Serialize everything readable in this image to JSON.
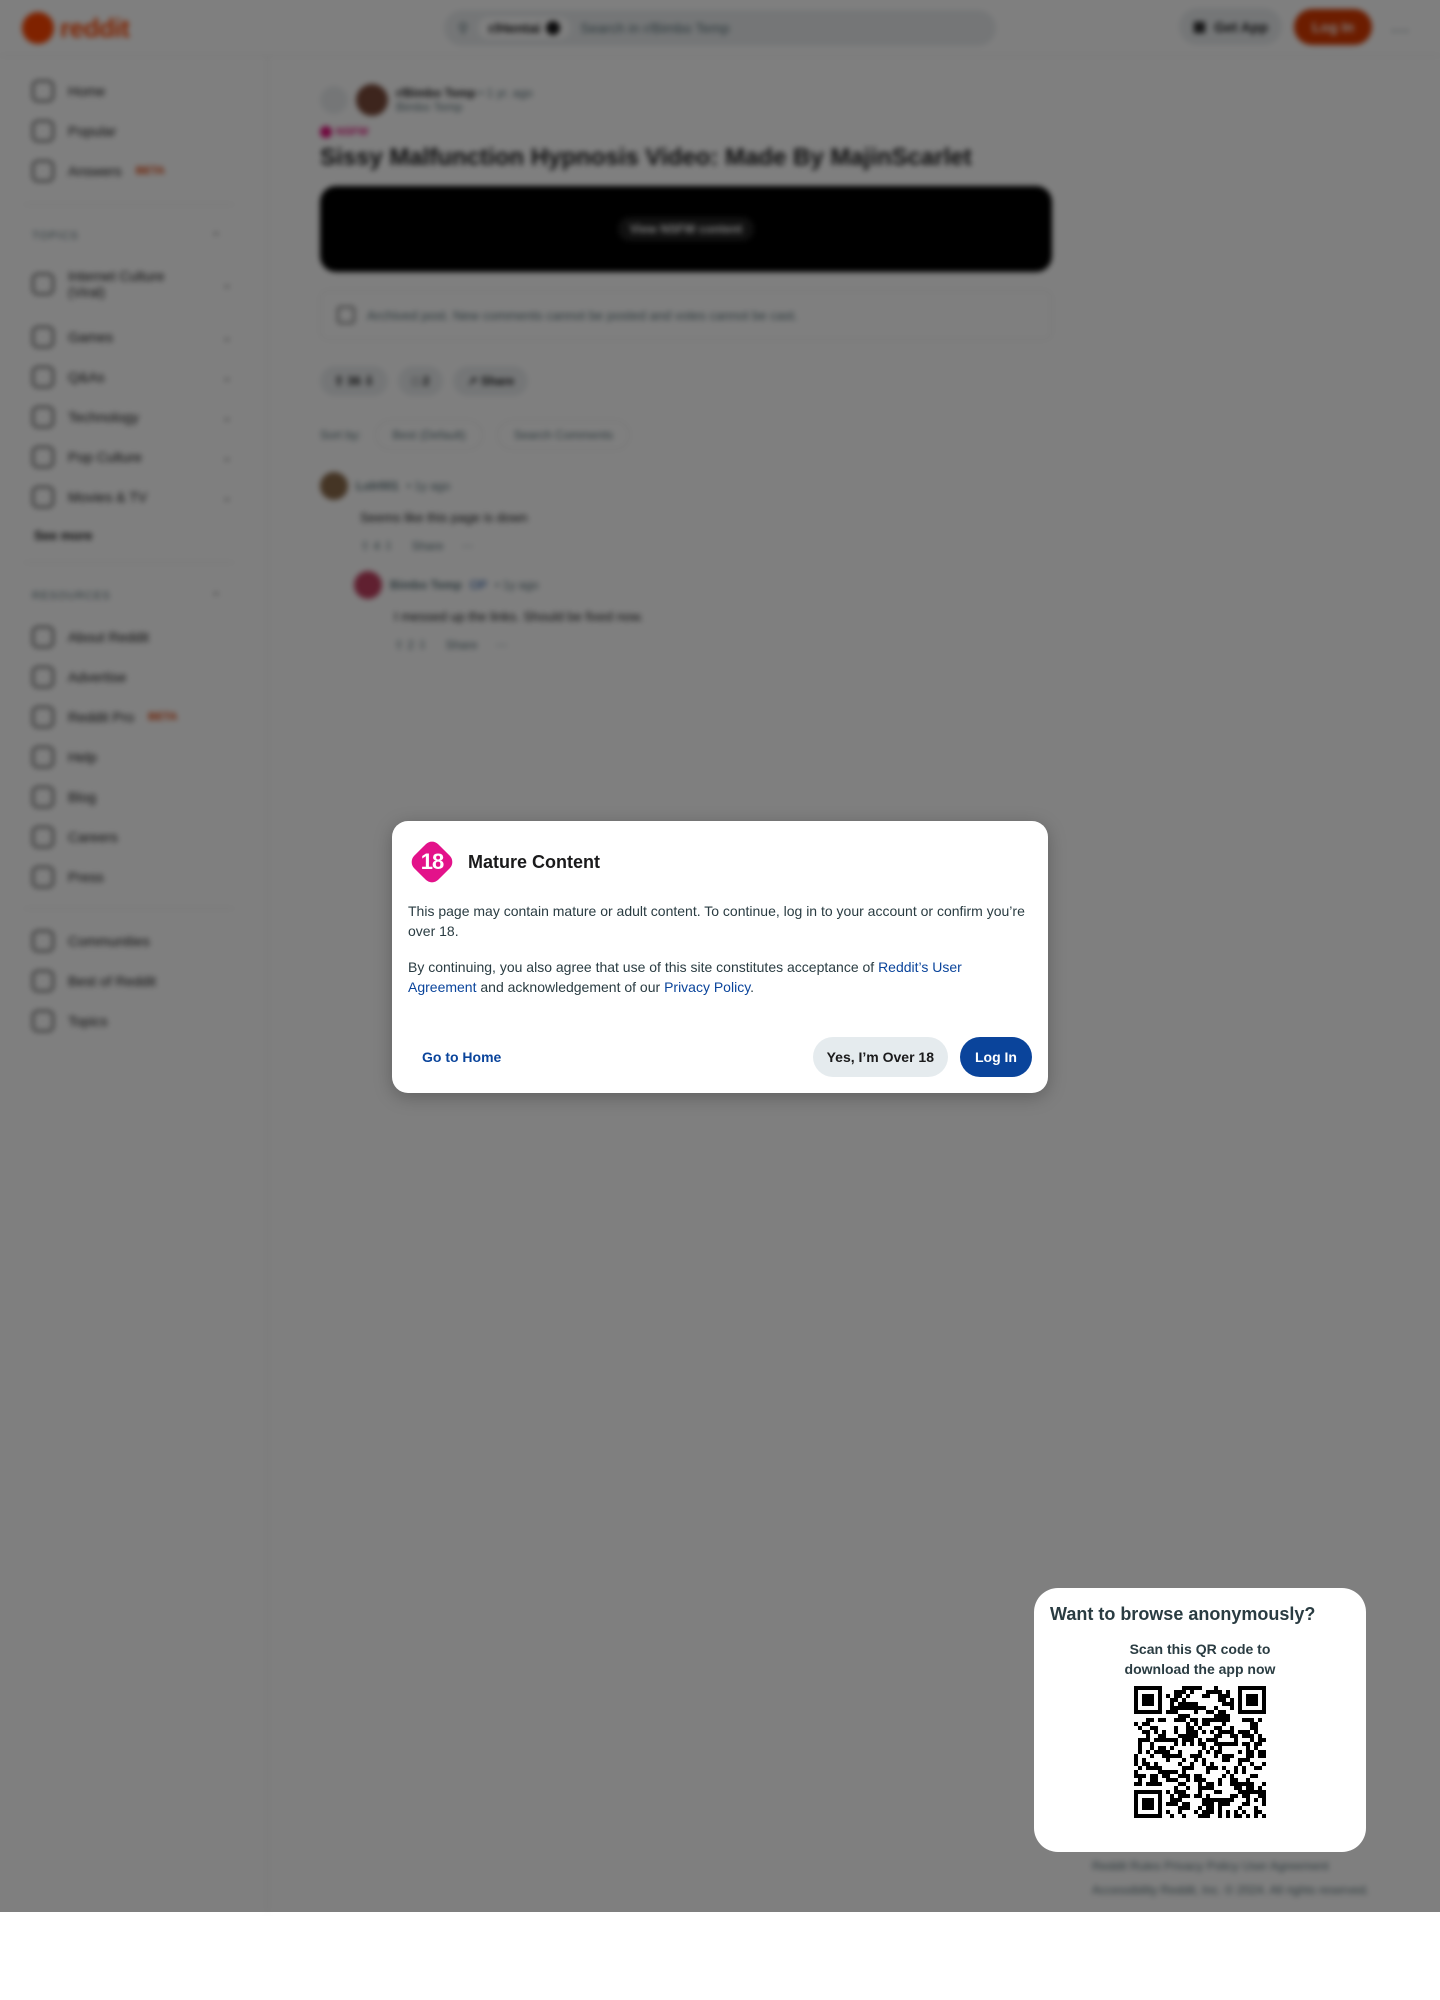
{
  "header": {
    "logo_text": "reddit",
    "search_chip": "r/Hentai",
    "search_placeholder": "Search in r/Bimbo Temp",
    "get_app": "Get App",
    "log_in": "Log In",
    "more": "…"
  },
  "sidebar": {
    "top": [
      {
        "label": "Home",
        "icon": "home-icon"
      },
      {
        "label": "Popular",
        "icon": "popular-icon"
      },
      {
        "label": "Answers",
        "icon": "answers-icon",
        "badge": "BETA"
      }
    ],
    "topics_label": "TOPICS",
    "topics": [
      {
        "label": "Internet Culture (Viral)"
      },
      {
        "label": "Games"
      },
      {
        "label": "Q&As"
      },
      {
        "label": "Technology"
      },
      {
        "label": "Pop Culture"
      },
      {
        "label": "Movies & TV"
      }
    ],
    "see_more": "See more",
    "resources_label": "RESOURCES",
    "resources": [
      {
        "label": "About Reddit"
      },
      {
        "label": "Advertise"
      },
      {
        "label": "Reddit Pro",
        "badge": "BETA"
      },
      {
        "label": "Help"
      },
      {
        "label": "Blog"
      },
      {
        "label": "Careers"
      },
      {
        "label": "Press"
      }
    ],
    "bottom": [
      {
        "label": "Communities"
      },
      {
        "label": "Best of Reddit"
      },
      {
        "label": "Topics"
      }
    ]
  },
  "post": {
    "subreddit": "r/Bimbo Temp",
    "time": "• 1 yr. ago",
    "author": "Bimbo Temp",
    "nsfw_tag": "NSFW",
    "title": "Sissy Malfunction Hypnosis Video: Made By MajinScarlet",
    "media_button": "View NSFW content",
    "archived_text": "Archived post. New comments cannot be posted and votes cannot be cast.",
    "votes": "36",
    "comments": "2",
    "share": "Share",
    "sort_label": "Sort by:",
    "sort_value": "Best (Default)",
    "search_comments": "Search Comments"
  },
  "comments": [
    {
      "author": "Lolr001",
      "time": "• 1y ago",
      "body": "Seems like this page is down",
      "votes": "4",
      "share": "Share"
    },
    {
      "author": "Bimbo Temp",
      "op": "OP",
      "time": "• 1y ago",
      "body": "I messed up the links. Should be fixed now.",
      "votes": "2",
      "share": "Share"
    }
  ],
  "footer": {
    "line1": "Reddit Rules  Privacy Policy  User Agreement",
    "line2": "Accessibility  Reddit, Inc. © 2024. All rights reserved."
  },
  "modal": {
    "badge": "18",
    "title": "Mature Content",
    "paragraph1": "This page may contain mature or adult content. To continue, log in to your account or confirm you’re over 18.",
    "p2_prefix": "By continuing, you also agree that use of this site constitutes acceptance of ",
    "p2_link1": "Reddit’s User Agreement",
    "p2_middle": " and acknowledgement of our ",
    "p2_link2": "Privacy Policy",
    "p2_suffix": ".",
    "go_home": "Go to Home",
    "over18": "Yes, I’m Over 18",
    "log_in": "Log In"
  },
  "qr": {
    "title": "Want to browse anonymously?",
    "subtitle_line1": "Scan this QR code to",
    "subtitle_line2": "download the app now"
  },
  "colors": {
    "brand": "#ff4500",
    "nsfw": "#e3128a",
    "link": "#0a449b",
    "overlay": "rgba(0,0,0,0.5)"
  }
}
